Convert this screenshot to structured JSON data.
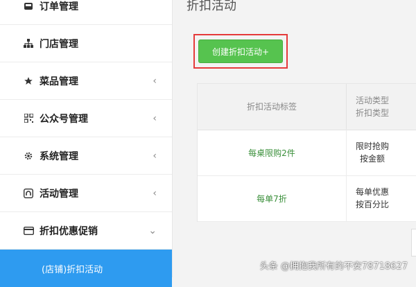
{
  "sidebar": {
    "items": [
      {
        "label": "订单管理",
        "icon": "inbox-icon",
        "chevron": ""
      },
      {
        "label": "门店管理",
        "icon": "sitemap-icon",
        "chevron": ""
      },
      {
        "label": "菜品管理",
        "icon": "star-icon",
        "chevron": "‹"
      },
      {
        "label": "公众号管理",
        "icon": "qrcode-icon",
        "chevron": "‹"
      },
      {
        "label": "系统管理",
        "icon": "gear-icon",
        "chevron": "‹"
      },
      {
        "label": "活动管理",
        "icon": "github-icon",
        "chevron": "‹"
      },
      {
        "label": "折扣优惠促销",
        "icon": "card-icon",
        "chevron": "⌄"
      }
    ],
    "active_sub": "(店铺)折扣活动"
  },
  "main": {
    "title": "折扣活动",
    "create_button": "创建折扣活动+",
    "table": {
      "headers": [
        "折扣活动标签",
        "活动类型\n折扣类型"
      ],
      "rows": [
        {
          "label": "每桌限购2件",
          "type": "限时抢购\n按金额"
        },
        {
          "label": "每单7折",
          "type": "每单优惠\n按百分比"
        }
      ]
    }
  },
  "watermark": "头条 @拥抱我所有的不安78718627",
  "colors": {
    "accent": "#2e9bf0",
    "button": "#56c34f",
    "highlight": "#e53a3a"
  }
}
